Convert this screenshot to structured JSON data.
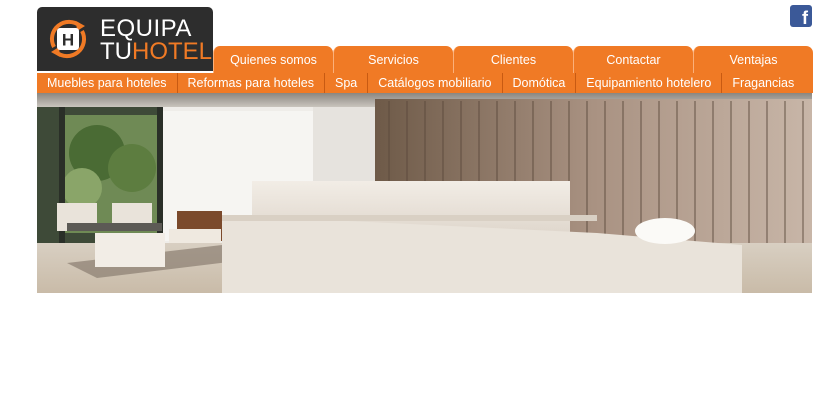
{
  "brand": {
    "line1": "EQUIPA",
    "line2_a": "TU",
    "line2_b": "HOTEL",
    "mark_letter": "H"
  },
  "social": {
    "facebook_glyph": "f"
  },
  "main_nav": [
    {
      "label": "Quienes somos"
    },
    {
      "label": "Servicios"
    },
    {
      "label": "Clientes"
    },
    {
      "label": "Contactar"
    },
    {
      "label": "Ventajas"
    }
  ],
  "sub_nav": [
    {
      "label": "Muebles para hoteles"
    },
    {
      "label": "Reformas para hoteles"
    },
    {
      "label": "Spa"
    },
    {
      "label": "Catálogos mobiliario"
    },
    {
      "label": "Domótica"
    },
    {
      "label": "Equipamiento hotelero"
    },
    {
      "label": "Fragancias"
    }
  ],
  "colors": {
    "accent": "#f07a25",
    "logo_bg": "#2d2d2d",
    "facebook": "#3b5998"
  }
}
